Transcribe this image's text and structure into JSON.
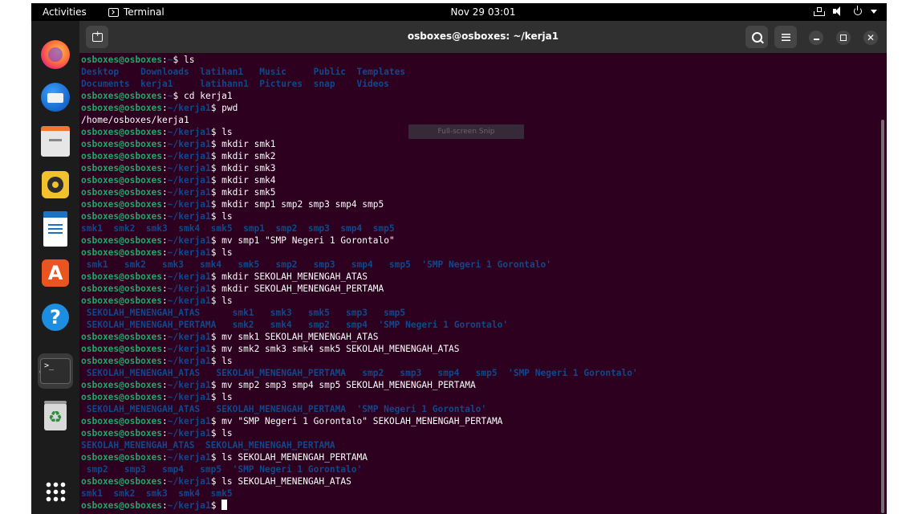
{
  "topbar": {
    "activities": "Activities",
    "app_name": "Terminal",
    "clock": "Nov 29  03:01"
  },
  "window": {
    "title": "osboxes@osboxes: ~/kerja1"
  },
  "dock": {
    "items": [
      "firefox",
      "thunderbird",
      "files",
      "rhythmbox",
      "libreoffice-writer",
      "ubuntu-software",
      "help",
      "terminal",
      "trash",
      "show-apps"
    ]
  },
  "overlay": {
    "snip_label": "Full-screen Snip"
  },
  "colors": {
    "terminal_bg": "#2c001e",
    "user_green": "#26a269",
    "path_blue": "#12488b",
    "accent_orange": "#e95420"
  },
  "terminal_lines": [
    {
      "type": "prompt",
      "user": "osboxes@osboxes",
      "cwd": "~",
      "cmd": "ls"
    },
    {
      "type": "output",
      "dir": true,
      "text": "Desktop    Downloads  latihan1   Music     Public  Templates"
    },
    {
      "type": "output",
      "dir": true,
      "text": "Documents  kerja1     latihann1  Pictures  snap    Videos"
    },
    {
      "type": "prompt",
      "user": "osboxes@osboxes",
      "cwd": "~",
      "cmd": "cd kerja1"
    },
    {
      "type": "prompt",
      "user": "osboxes@osboxes",
      "cwd": "~/kerja1",
      "cmd": "pwd"
    },
    {
      "type": "output",
      "dir": false,
      "text": "/home/osboxes/kerja1"
    },
    {
      "type": "prompt",
      "user": "osboxes@osboxes",
      "cwd": "~/kerja1",
      "cmd": "ls"
    },
    {
      "type": "prompt",
      "user": "osboxes@osboxes",
      "cwd": "~/kerja1",
      "cmd": "mkdir smk1"
    },
    {
      "type": "prompt",
      "user": "osboxes@osboxes",
      "cwd": "~/kerja1",
      "cmd": "mkdir smk2"
    },
    {
      "type": "prompt",
      "user": "osboxes@osboxes",
      "cwd": "~/kerja1",
      "cmd": "mkdir smk3"
    },
    {
      "type": "prompt",
      "user": "osboxes@osboxes",
      "cwd": "~/kerja1",
      "cmd": "mkdir smk4"
    },
    {
      "type": "prompt",
      "user": "osboxes@osboxes",
      "cwd": "~/kerja1",
      "cmd": "mkdir smk5"
    },
    {
      "type": "prompt",
      "user": "osboxes@osboxes",
      "cwd": "~/kerja1",
      "cmd": "mkdir smp1 smp2 smp3 smp4 smp5"
    },
    {
      "type": "prompt",
      "user": "osboxes@osboxes",
      "cwd": "~/kerja1",
      "cmd": "ls"
    },
    {
      "type": "output",
      "dir": true,
      "text": "smk1  smk2  smk3  smk4  smk5  smp1  smp2  smp3  smp4  smp5"
    },
    {
      "type": "prompt",
      "user": "osboxes@osboxes",
      "cwd": "~/kerja1",
      "cmd": "mv smp1 \"SMP Negeri 1 Gorontalo\""
    },
    {
      "type": "prompt",
      "user": "osboxes@osboxes",
      "cwd": "~/kerja1",
      "cmd": "ls"
    },
    {
      "type": "output",
      "dir": true,
      "text": " smk1   smk2   smk3   smk4   smk5   smp2   smp3   smp4   smp5  'SMP Negeri 1 Gorontalo'"
    },
    {
      "type": "prompt",
      "user": "osboxes@osboxes",
      "cwd": "~/kerja1",
      "cmd": "mkdir SEKOLAH_MENENGAH_ATAS"
    },
    {
      "type": "prompt",
      "user": "osboxes@osboxes",
      "cwd": "~/kerja1",
      "cmd": "mkdir SEKOLAH_MENENGAH_PERTAMA"
    },
    {
      "type": "prompt",
      "user": "osboxes@osboxes",
      "cwd": "~/kerja1",
      "cmd": "ls"
    },
    {
      "type": "output",
      "dir": true,
      "text": " SEKOLAH_MENENGAH_ATAS      smk1   smk3   smk5   smp3   smp5"
    },
    {
      "type": "output",
      "dir": true,
      "text": " SEKOLAH_MENENGAH_PERTAMA   smk2   smk4   smp2   smp4  'SMP Negeri 1 Gorontalo'"
    },
    {
      "type": "prompt",
      "user": "osboxes@osboxes",
      "cwd": "~/kerja1",
      "cmd": "mv smk1 SEKOLAH_MENENGAH_ATAS"
    },
    {
      "type": "prompt",
      "user": "osboxes@osboxes",
      "cwd": "~/kerja1",
      "cmd": "mv smk2 smk3 smk4 smk5 SEKOLAH_MENENGAH_ATAS"
    },
    {
      "type": "prompt",
      "user": "osboxes@osboxes",
      "cwd": "~/kerja1",
      "cmd": "ls"
    },
    {
      "type": "output",
      "dir": true,
      "text": " SEKOLAH_MENENGAH_ATAS   SEKOLAH_MENENGAH_PERTAMA   smp2   smp3   smp4   smp5  'SMP Negeri 1 Gorontalo'"
    },
    {
      "type": "prompt",
      "user": "osboxes@osboxes",
      "cwd": "~/kerja1",
      "cmd": "mv smp2 smp3 smp4 smp5 SEKOLAH_MENENGAH_PERTAMA"
    },
    {
      "type": "prompt",
      "user": "osboxes@osboxes",
      "cwd": "~/kerja1",
      "cmd": "ls"
    },
    {
      "type": "output",
      "dir": true,
      "text": " SEKOLAH_MENENGAH_ATAS   SEKOLAH_MENENGAH_PERTAMA  'SMP Negeri 1 Gorontalo'"
    },
    {
      "type": "prompt",
      "user": "osboxes@osboxes",
      "cwd": "~/kerja1",
      "cmd": "mv \"SMP Negeri 1 Gorontalo\" SEKOLAH_MENENGAH_PERTAMA"
    },
    {
      "type": "prompt",
      "user": "osboxes@osboxes",
      "cwd": "~/kerja1",
      "cmd": "ls"
    },
    {
      "type": "output",
      "dir": true,
      "text": "SEKOLAH_MENENGAH_ATAS  SEKOLAH_MENENGAH_PERTAMA"
    },
    {
      "type": "prompt",
      "user": "osboxes@osboxes",
      "cwd": "~/kerja1",
      "cmd": "ls SEKOLAH_MENENGAH_PERTAMA"
    },
    {
      "type": "output",
      "dir": true,
      "text": " smp2   smp3   smp4   smp5  'SMP Negeri 1 Gorontalo'"
    },
    {
      "type": "prompt",
      "user": "osboxes@osboxes",
      "cwd": "~/kerja1",
      "cmd": "ls SEKOLAH_MENENGAH_ATAS"
    },
    {
      "type": "output",
      "dir": true,
      "text": "smk1  smk2  smk3  smk4  smk5"
    },
    {
      "type": "prompt",
      "user": "osboxes@osboxes",
      "cwd": "~/kerja1",
      "cmd": "",
      "cursor": true
    }
  ]
}
